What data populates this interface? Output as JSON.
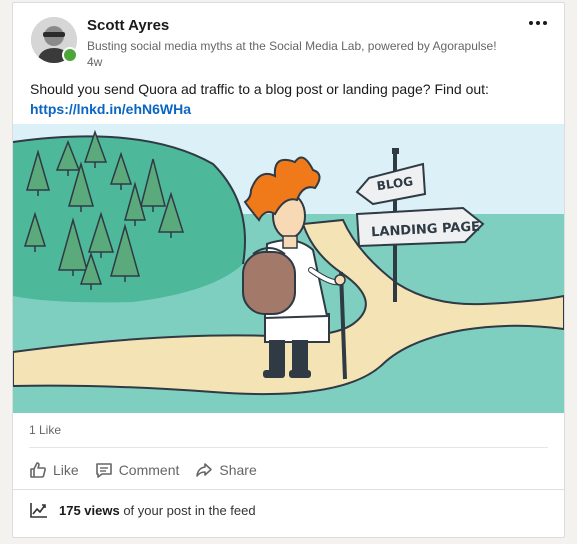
{
  "post": {
    "author_name": "Scott Ayres",
    "author_headline": "Busting social media myths at the Social Media Lab, powered by Agorapulse!",
    "time_ago": "4w",
    "text": "Should you send Quora ad traffic to a blog post or landing page? Find out: ",
    "link": "https://lnkd.in/ehN6WHa"
  },
  "image": {
    "sign_top": "BLOG",
    "sign_bottom": "LANDING PAGE"
  },
  "social": {
    "likes": "1 Like"
  },
  "actions": {
    "like_label": "Like",
    "comment_label": "Comment",
    "share_label": "Share"
  },
  "views": {
    "count": "175 views",
    "suffix": " of your post in the feed"
  },
  "colors": {
    "link": "#0a66c2",
    "online": "#4ea53a",
    "sky": "#dcf0f8",
    "grass": "#7ecfc0",
    "hill": "#4db89a",
    "tree": "#5aaa7c",
    "path": "#f3e3b5",
    "hair": "#f07a1a",
    "backpack": "#a3796a"
  }
}
